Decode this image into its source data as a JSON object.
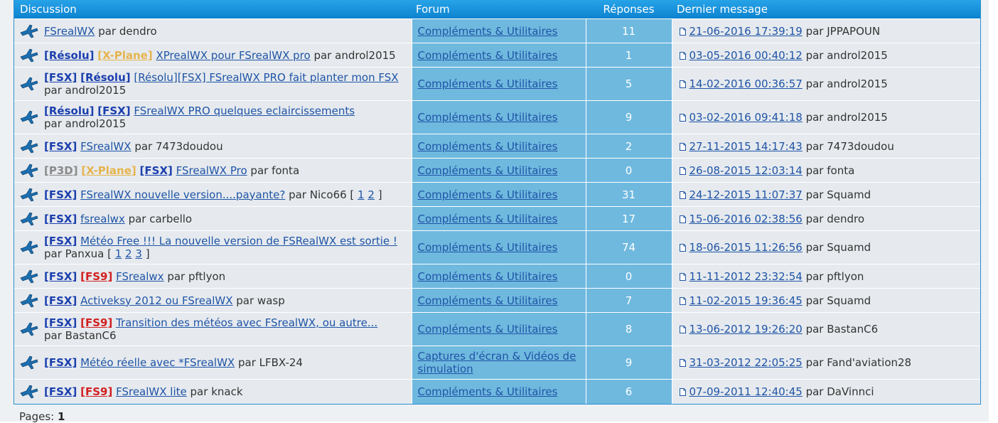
{
  "header": {
    "discussion": "Discussion",
    "forum": "Forum",
    "replies": "Réponses",
    "last_message": "Dernier message"
  },
  "rows": [
    {
      "parts": [
        {
          "t": "FSrealWX",
          "c": "link"
        }
      ],
      "by": "par",
      "author": "dendro",
      "forum": "Compléments & Utilitaires",
      "replies": "11",
      "date": "21-06-2016 17:39:19",
      "last_by": "par JPPAPOUN",
      "h": 34
    },
    {
      "parts": [
        {
          "t": "[Résolu]",
          "c": "tag tag-resolu"
        },
        {
          "t": " "
        },
        {
          "t": "[X-Plane]",
          "c": "tag tag-xplane"
        },
        {
          "t": " "
        },
        {
          "t": "XPrealWX pour FSrealWX pro",
          "c": "link"
        }
      ],
      "by": "par",
      "author": "androl2015",
      "forum": "Compléments & Utilitaires",
      "replies": "1",
      "date": "03-05-2016 00:40:12",
      "last_by": "par androl2015",
      "h": 34
    },
    {
      "parts": [
        {
          "t": "[FSX]",
          "c": "tag tag-fsx"
        },
        {
          "t": " "
        },
        {
          "t": "[Résolu]",
          "c": "tag tag-resolu"
        },
        {
          "t": " "
        },
        {
          "t": "[Résolu][FSX] FSrealWX PRO fait planter mon FSX",
          "c": "link"
        }
      ],
      "by": "par",
      "author": "androl2015",
      "wrap": true,
      "forum": "Compléments & Utilitaires",
      "replies": "5",
      "date": "14-02-2016 00:36:57",
      "last_by": "par androl2015",
      "h": 47
    },
    {
      "parts": [
        {
          "t": "[Résolu]",
          "c": "tag tag-resolu"
        },
        {
          "t": " "
        },
        {
          "t": "[FSX]",
          "c": "tag tag-fsx"
        },
        {
          "t": " "
        },
        {
          "t": "FSrealWX PRO quelques eclaircissements",
          "c": "link"
        }
      ],
      "by": "par",
      "author": "androl2015",
      "wrap": true,
      "forum": "Compléments & Utilitaires",
      "replies": "9",
      "date": "03-02-2016 09:41:18",
      "last_by": "par androl2015",
      "h": 47
    },
    {
      "parts": [
        {
          "t": "[FSX]",
          "c": "tag tag-fsx"
        },
        {
          "t": " "
        },
        {
          "t": "FSrealWX",
          "c": "link"
        }
      ],
      "by": "par",
      "author": "7473doudou",
      "forum": "Compléments & Utilitaires",
      "replies": "2",
      "date": "27-11-2015 14:17:43",
      "last_by": "par 7473doudou",
      "h": 34
    },
    {
      "parts": [
        {
          "t": "[P3D]",
          "c": "tag tag-p3d"
        },
        {
          "t": " "
        },
        {
          "t": "[X-Plane]",
          "c": "tag tag-xplane"
        },
        {
          "t": " "
        },
        {
          "t": "[FSX]",
          "c": "tag tag-fsx"
        },
        {
          "t": " "
        },
        {
          "t": "FSrealWX Pro",
          "c": "link"
        }
      ],
      "by": "par",
      "author": "fonta",
      "forum": "Compléments & Utilitaires",
      "replies": "0",
      "date": "26-08-2015 12:03:14",
      "last_by": "par fonta",
      "h": 34
    },
    {
      "parts": [
        {
          "t": "[FSX]",
          "c": "tag tag-fsx"
        },
        {
          "t": " "
        },
        {
          "t": "FSrealWX nouvelle version....payante?",
          "c": "link"
        }
      ],
      "by": "par",
      "author": "Nico66",
      "pages": [
        "1",
        "2"
      ],
      "forum": "Compléments & Utilitaires",
      "replies": "31",
      "date": "24-12-2015 11:07:37",
      "last_by": "par Squamd",
      "h": 34
    },
    {
      "parts": [
        {
          "t": "[FSX]",
          "c": "tag tag-fsx"
        },
        {
          "t": " "
        },
        {
          "t": "fsrealwx",
          "c": "link"
        }
      ],
      "by": "par",
      "author": "carbello",
      "forum": "Compléments & Utilitaires",
      "replies": "17",
      "date": "15-06-2016 02:38:56",
      "last_by": "par dendro",
      "h": 34
    },
    {
      "parts": [
        {
          "t": "[FSX]",
          "c": "tag tag-fsx"
        },
        {
          "t": " "
        },
        {
          "t": "Météo Free !!! La nouvelle version de FSRealWX est sortie !",
          "c": "link"
        }
      ],
      "by": "par",
      "author": "Panxua",
      "wrap": true,
      "pages": [
        "1",
        "2",
        "3"
      ],
      "forum": "Compléments & Utilitaires",
      "replies": "74",
      "date": "18-06-2015 11:26:56",
      "last_by": "par Squamd",
      "h": 47
    },
    {
      "parts": [
        {
          "t": "[FSX]",
          "c": "tag tag-fsx"
        },
        {
          "t": " "
        },
        {
          "t": "[FS9]",
          "c": "tag tag-fs9"
        },
        {
          "t": " "
        },
        {
          "t": "FSrealwx",
          "c": "link"
        }
      ],
      "by": "par",
      "author": "pftlyon",
      "forum": "Compléments & Utilitaires",
      "replies": "0",
      "date": "11-11-2012 23:32:54",
      "last_by": "par pftlyon",
      "h": 34
    },
    {
      "parts": [
        {
          "t": "[FSX]",
          "c": "tag tag-fsx"
        },
        {
          "t": " "
        },
        {
          "t": "Activeksy 2012 ou FSrealWX",
          "c": "link"
        }
      ],
      "by": "par",
      "author": "wasp",
      "forum": "Compléments & Utilitaires",
      "replies": "7",
      "date": "11-02-2015 19:36:45",
      "last_by": "par Squamd",
      "h": 34
    },
    {
      "parts": [
        {
          "t": "[FSX]",
          "c": "tag tag-fsx"
        },
        {
          "t": " "
        },
        {
          "t": "[FS9]",
          "c": "tag tag-fs9"
        },
        {
          "t": " "
        },
        {
          "t": "Transition des météos avec FSrealWX, ou autre...",
          "c": "link"
        }
      ],
      "by": "par",
      "author": "BastanC6",
      "wrap": true,
      "forum": "Compléments & Utilitaires",
      "replies": "8",
      "date": "13-06-2012 19:26:20",
      "last_by": "par BastanC6",
      "h": 47
    },
    {
      "parts": [
        {
          "t": "[FSX]",
          "c": "tag tag-fsx"
        },
        {
          "t": " "
        },
        {
          "t": "Météo réelle avec *FSrealWX",
          "c": "link"
        }
      ],
      "by": "par",
      "author": "LFBX-24",
      "forum": "Captures d'écran & Vidéos de simulation",
      "replies": "9",
      "date": "31-03-2012 22:05:25",
      "last_by": "par Fand'aviation28",
      "h": 47
    },
    {
      "parts": [
        {
          "t": "[FSX]",
          "c": "tag tag-fsx"
        },
        {
          "t": " "
        },
        {
          "t": "[FS9]",
          "c": "tag tag-fs9"
        },
        {
          "t": " "
        },
        {
          "t": "FSrealWX lite",
          "c": "link"
        }
      ],
      "by": "par",
      "author": "knack",
      "forum": "Compléments & Utilitaires",
      "replies": "6",
      "date": "07-09-2011 12:40:45",
      "last_by": "par DaVinnci",
      "h": 34
    }
  ],
  "footer": {
    "label": "Pages:",
    "page": "1"
  },
  "colors": {
    "header_blue": "#1590d8",
    "forum_cell": "#6fb9df",
    "tag_fsx": "#1b3fae",
    "tag_xplane": "#e6b44e",
    "tag_fs9": "#d22020",
    "tag_p3d": "#8a8a8a"
  }
}
